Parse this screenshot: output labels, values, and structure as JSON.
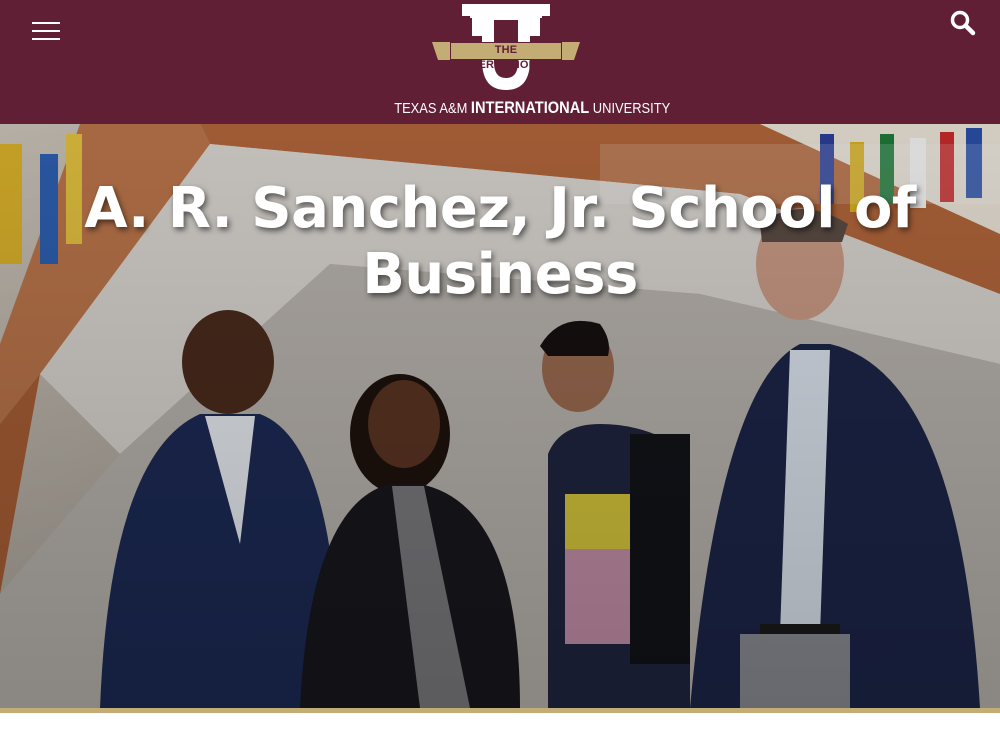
{
  "header": {
    "logo": {
      "band_text": "THE INTERNATIONAL",
      "wordmark_left": "TEXAS A&M",
      "wordmark_bold": "INTERNATIONAL",
      "wordmark_right": "UNIVERSITY"
    },
    "icons": {
      "menu": "hamburger-menu-icon",
      "search": "search-icon"
    }
  },
  "hero": {
    "title": "A. R. Sanchez, Jr. School of Business"
  },
  "colors": {
    "brand_maroon": "#611f36",
    "brand_gold": "#c3ad75",
    "text_on_dark": "#ffffff"
  }
}
